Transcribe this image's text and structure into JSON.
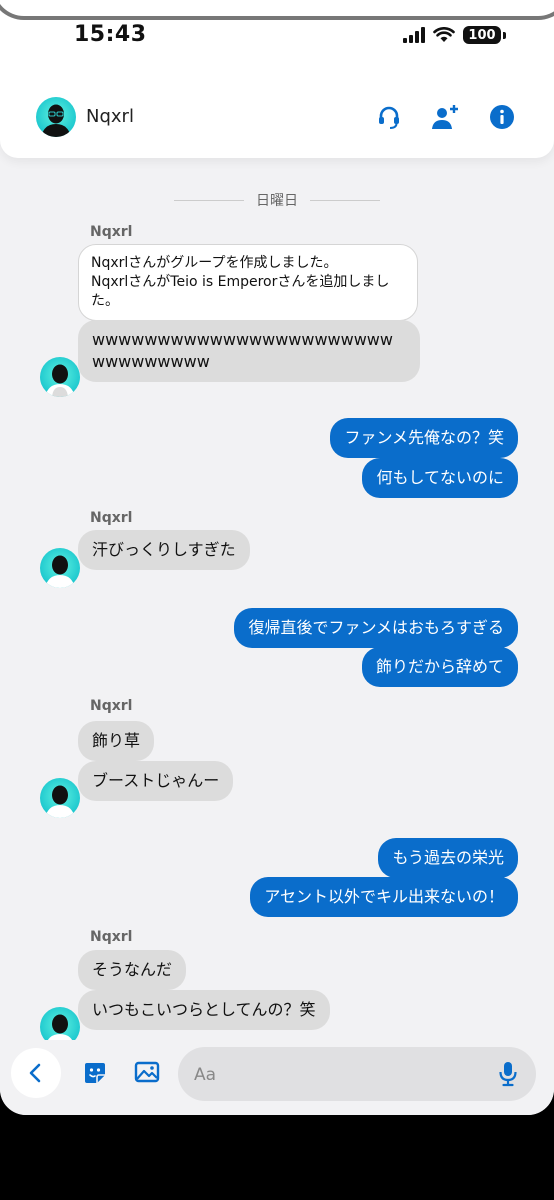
{
  "status_bar": {
    "time": "15:43",
    "battery": "100"
  },
  "header": {
    "contact_name": "Nqxrl"
  },
  "date_separator": "日曜日",
  "messages": [
    {
      "sender": "Nqxrl"
    },
    {
      "text": "Nqxrlさんがグループを作成しました。\nNqxrlさんがTeio is Emperorさんを追加しました。"
    },
    {
      "text": "wwwwwwwwwwwwwwwwwwwwwwwwwwwwwwww"
    },
    {
      "text": "ファンメ先俺なの？笑"
    },
    {
      "text": "何もしてないのに"
    },
    {
      "sender": "Nqxrl"
    },
    {
      "text": "汗びっくりしすぎた"
    },
    {
      "text": "復帰直後でファンメはおもろすぎる"
    },
    {
      "text": "飾りだから辞めて"
    },
    {
      "sender": "Nqxrl"
    },
    {
      "text": "飾り草"
    },
    {
      "text": "ブーストじゃんー"
    },
    {
      "text": "もう過去の栄光"
    },
    {
      "text": "アセント以外でキル出来ないの！"
    },
    {
      "sender": "Nqxrl"
    },
    {
      "text": "そうなんだ"
    },
    {
      "text": "いつもこいつらとしてんの？笑"
    }
  ],
  "composer": {
    "placeholder": "Aa"
  },
  "colors": {
    "outgoing": "#0a6dcb",
    "incoming": "#dcdcdc",
    "accent": "#0a6dcb"
  },
  "icons": [
    "headset-icon",
    "add-person-icon",
    "info-icon",
    "back-chevron-icon",
    "sticker-icon",
    "image-icon",
    "microphone-icon"
  ]
}
